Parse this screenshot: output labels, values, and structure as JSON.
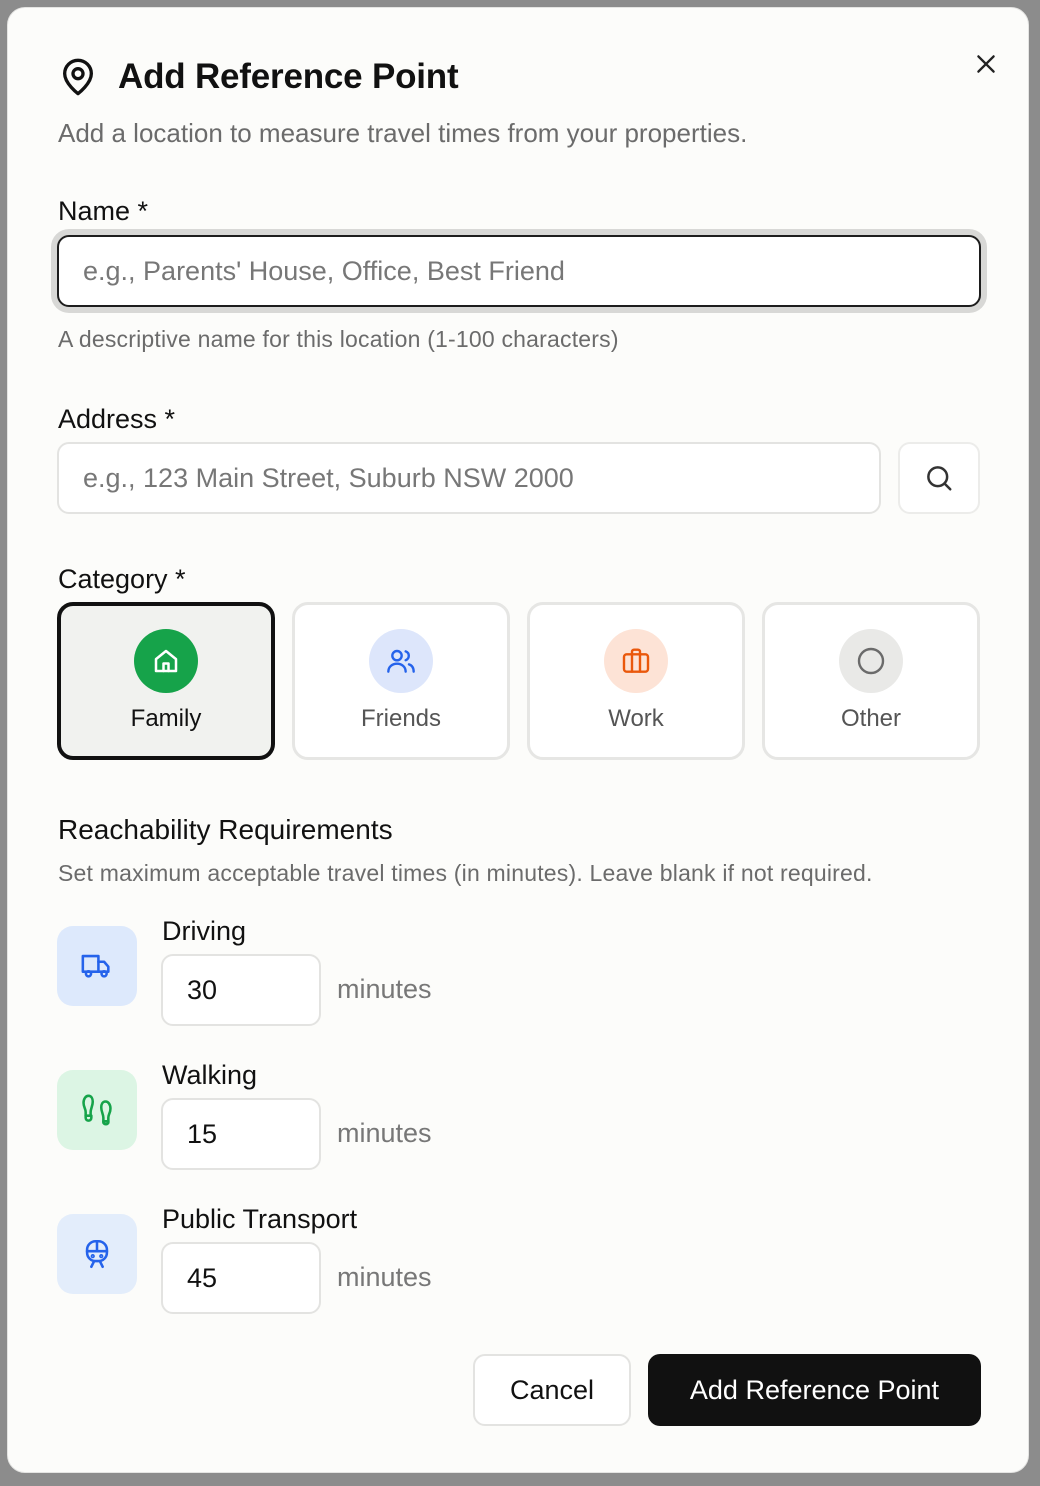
{
  "dialog": {
    "title": "Add Reference Point",
    "subtitle": "Add a location to measure travel times from your properties."
  },
  "name_field": {
    "label": "Name *",
    "placeholder": "e.g., Parents' House, Office, Best Friend",
    "value": "",
    "hint": "A descriptive name for this location (1-100 characters)"
  },
  "address_field": {
    "label": "Address *",
    "placeholder": "e.g., 123 Main Street, Suburb NSW 2000",
    "value": ""
  },
  "category": {
    "label": "Category *",
    "selected": "Family",
    "options": [
      {
        "label": "Family",
        "icon": "home-icon",
        "bg": "#16a34a",
        "fg": "#ffffff"
      },
      {
        "label": "Friends",
        "icon": "users-icon",
        "bg": "#dde6fb",
        "fg": "#2563eb"
      },
      {
        "label": "Work",
        "icon": "briefcase-icon",
        "bg": "#fde3d6",
        "fg": "#ea580c"
      },
      {
        "label": "Other",
        "icon": "circle-icon",
        "bg": "#e9e9e7",
        "fg": "#6b6b6b"
      }
    ]
  },
  "reachability": {
    "title": "Reachability Requirements",
    "subtitle": "Set maximum acceptable travel times (in minutes). Leave blank if not required.",
    "unit": "minutes",
    "modes": [
      {
        "label": "Driving",
        "value": "30",
        "icon": "truck-icon",
        "bg": "#dde9fc",
        "fg": "#2563eb"
      },
      {
        "label": "Walking",
        "value": "15",
        "icon": "footprints-icon",
        "bg": "#dcf5e4",
        "fg": "#16a34a"
      },
      {
        "label": "Public Transport",
        "value": "45",
        "icon": "train-icon",
        "bg": "#e3edfb",
        "fg": "#2563eb"
      }
    ]
  },
  "actions": {
    "cancel": "Cancel",
    "submit": "Add Reference Point"
  }
}
